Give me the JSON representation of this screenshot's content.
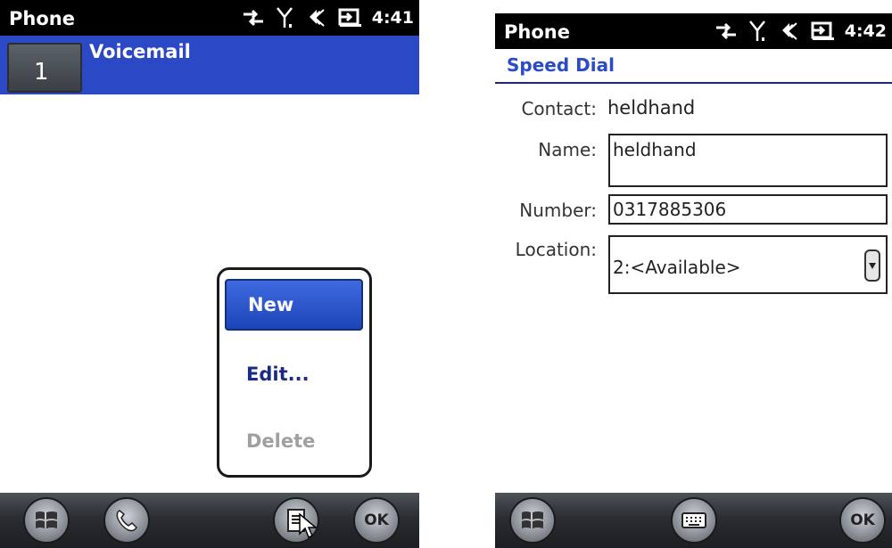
{
  "left": {
    "titlebar": {
      "app": "Phone",
      "time": "4:41"
    },
    "voicemail": {
      "key": "1",
      "label": "Voicemail"
    },
    "menu": {
      "items": [
        "New",
        "Edit...",
        "Delete"
      ]
    },
    "bottombar": {
      "ok": "OK"
    }
  },
  "right": {
    "titlebar": {
      "app": "Phone",
      "time": "4:42"
    },
    "header": "Speed Dial",
    "form": {
      "contact_label": "Contact:",
      "contact_value": "heldhand",
      "name_label": "Name:",
      "name_value": "heldhand",
      "number_label": "Number:",
      "number_value": "0317885306",
      "location_label": "Location:",
      "location_value": "2:<Available>"
    },
    "bottombar": {
      "ok": "OK"
    }
  },
  "icons": {
    "start": "windows-logo-icon",
    "phone": "phone-handset-icon",
    "menu": "menu-document-icon",
    "keyboard": "keyboard-icon",
    "data": "data-connection-icon",
    "signal": "signal-strength-icon",
    "volume": "speaker-icon",
    "battery": "battery-charging-icon"
  },
  "colors": {
    "selection": "#2b49c5",
    "header_text": "#2b4bc8",
    "menu_text": "#1a2a86"
  }
}
